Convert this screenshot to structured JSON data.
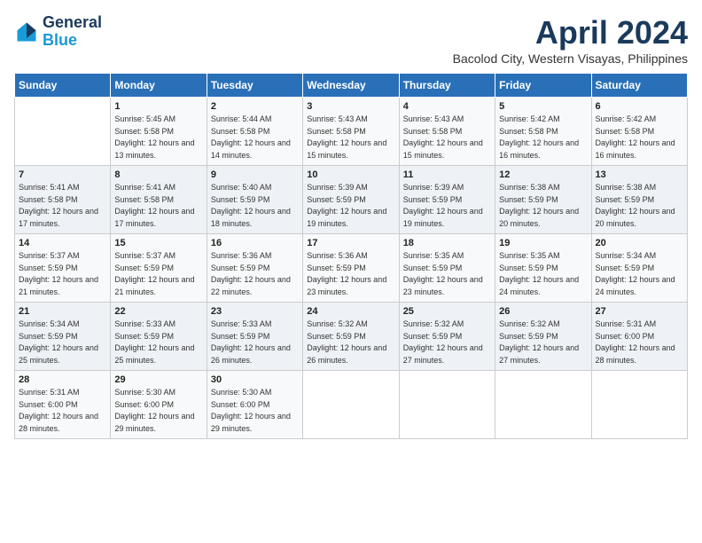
{
  "logo": {
    "line1": "General",
    "line2": "Blue"
  },
  "title": "April 2024",
  "subtitle": "Bacolod City, Western Visayas, Philippines",
  "days_of_week": [
    "Sunday",
    "Monday",
    "Tuesday",
    "Wednesday",
    "Thursday",
    "Friday",
    "Saturday"
  ],
  "weeks": [
    [
      {
        "day": "",
        "sunrise": "",
        "sunset": "",
        "daylight": ""
      },
      {
        "day": "1",
        "sunrise": "Sunrise: 5:45 AM",
        "sunset": "Sunset: 5:58 PM",
        "daylight": "Daylight: 12 hours and 13 minutes."
      },
      {
        "day": "2",
        "sunrise": "Sunrise: 5:44 AM",
        "sunset": "Sunset: 5:58 PM",
        "daylight": "Daylight: 12 hours and 14 minutes."
      },
      {
        "day": "3",
        "sunrise": "Sunrise: 5:43 AM",
        "sunset": "Sunset: 5:58 PM",
        "daylight": "Daylight: 12 hours and 15 minutes."
      },
      {
        "day": "4",
        "sunrise": "Sunrise: 5:43 AM",
        "sunset": "Sunset: 5:58 PM",
        "daylight": "Daylight: 12 hours and 15 minutes."
      },
      {
        "day": "5",
        "sunrise": "Sunrise: 5:42 AM",
        "sunset": "Sunset: 5:58 PM",
        "daylight": "Daylight: 12 hours and 16 minutes."
      },
      {
        "day": "6",
        "sunrise": "Sunrise: 5:42 AM",
        "sunset": "Sunset: 5:58 PM",
        "daylight": "Daylight: 12 hours and 16 minutes."
      }
    ],
    [
      {
        "day": "7",
        "sunrise": "Sunrise: 5:41 AM",
        "sunset": "Sunset: 5:58 PM",
        "daylight": "Daylight: 12 hours and 17 minutes."
      },
      {
        "day": "8",
        "sunrise": "Sunrise: 5:41 AM",
        "sunset": "Sunset: 5:58 PM",
        "daylight": "Daylight: 12 hours and 17 minutes."
      },
      {
        "day": "9",
        "sunrise": "Sunrise: 5:40 AM",
        "sunset": "Sunset: 5:59 PM",
        "daylight": "Daylight: 12 hours and 18 minutes."
      },
      {
        "day": "10",
        "sunrise": "Sunrise: 5:39 AM",
        "sunset": "Sunset: 5:59 PM",
        "daylight": "Daylight: 12 hours and 19 minutes."
      },
      {
        "day": "11",
        "sunrise": "Sunrise: 5:39 AM",
        "sunset": "Sunset: 5:59 PM",
        "daylight": "Daylight: 12 hours and 19 minutes."
      },
      {
        "day": "12",
        "sunrise": "Sunrise: 5:38 AM",
        "sunset": "Sunset: 5:59 PM",
        "daylight": "Daylight: 12 hours and 20 minutes."
      },
      {
        "day": "13",
        "sunrise": "Sunrise: 5:38 AM",
        "sunset": "Sunset: 5:59 PM",
        "daylight": "Daylight: 12 hours and 20 minutes."
      }
    ],
    [
      {
        "day": "14",
        "sunrise": "Sunrise: 5:37 AM",
        "sunset": "Sunset: 5:59 PM",
        "daylight": "Daylight: 12 hours and 21 minutes."
      },
      {
        "day": "15",
        "sunrise": "Sunrise: 5:37 AM",
        "sunset": "Sunset: 5:59 PM",
        "daylight": "Daylight: 12 hours and 21 minutes."
      },
      {
        "day": "16",
        "sunrise": "Sunrise: 5:36 AM",
        "sunset": "Sunset: 5:59 PM",
        "daylight": "Daylight: 12 hours and 22 minutes."
      },
      {
        "day": "17",
        "sunrise": "Sunrise: 5:36 AM",
        "sunset": "Sunset: 5:59 PM",
        "daylight": "Daylight: 12 hours and 23 minutes."
      },
      {
        "day": "18",
        "sunrise": "Sunrise: 5:35 AM",
        "sunset": "Sunset: 5:59 PM",
        "daylight": "Daylight: 12 hours and 23 minutes."
      },
      {
        "day": "19",
        "sunrise": "Sunrise: 5:35 AM",
        "sunset": "Sunset: 5:59 PM",
        "daylight": "Daylight: 12 hours and 24 minutes."
      },
      {
        "day": "20",
        "sunrise": "Sunrise: 5:34 AM",
        "sunset": "Sunset: 5:59 PM",
        "daylight": "Daylight: 12 hours and 24 minutes."
      }
    ],
    [
      {
        "day": "21",
        "sunrise": "Sunrise: 5:34 AM",
        "sunset": "Sunset: 5:59 PM",
        "daylight": "Daylight: 12 hours and 25 minutes."
      },
      {
        "day": "22",
        "sunrise": "Sunrise: 5:33 AM",
        "sunset": "Sunset: 5:59 PM",
        "daylight": "Daylight: 12 hours and 25 minutes."
      },
      {
        "day": "23",
        "sunrise": "Sunrise: 5:33 AM",
        "sunset": "Sunset: 5:59 PM",
        "daylight": "Daylight: 12 hours and 26 minutes."
      },
      {
        "day": "24",
        "sunrise": "Sunrise: 5:32 AM",
        "sunset": "Sunset: 5:59 PM",
        "daylight": "Daylight: 12 hours and 26 minutes."
      },
      {
        "day": "25",
        "sunrise": "Sunrise: 5:32 AM",
        "sunset": "Sunset: 5:59 PM",
        "daylight": "Daylight: 12 hours and 27 minutes."
      },
      {
        "day": "26",
        "sunrise": "Sunrise: 5:32 AM",
        "sunset": "Sunset: 5:59 PM",
        "daylight": "Daylight: 12 hours and 27 minutes."
      },
      {
        "day": "27",
        "sunrise": "Sunrise: 5:31 AM",
        "sunset": "Sunset: 6:00 PM",
        "daylight": "Daylight: 12 hours and 28 minutes."
      }
    ],
    [
      {
        "day": "28",
        "sunrise": "Sunrise: 5:31 AM",
        "sunset": "Sunset: 6:00 PM",
        "daylight": "Daylight: 12 hours and 28 minutes."
      },
      {
        "day": "29",
        "sunrise": "Sunrise: 5:30 AM",
        "sunset": "Sunset: 6:00 PM",
        "daylight": "Daylight: 12 hours and 29 minutes."
      },
      {
        "day": "30",
        "sunrise": "Sunrise: 5:30 AM",
        "sunset": "Sunset: 6:00 PM",
        "daylight": "Daylight: 12 hours and 29 minutes."
      },
      {
        "day": "",
        "sunrise": "",
        "sunset": "",
        "daylight": ""
      },
      {
        "day": "",
        "sunrise": "",
        "sunset": "",
        "daylight": ""
      },
      {
        "day": "",
        "sunrise": "",
        "sunset": "",
        "daylight": ""
      },
      {
        "day": "",
        "sunrise": "",
        "sunset": "",
        "daylight": ""
      }
    ]
  ]
}
